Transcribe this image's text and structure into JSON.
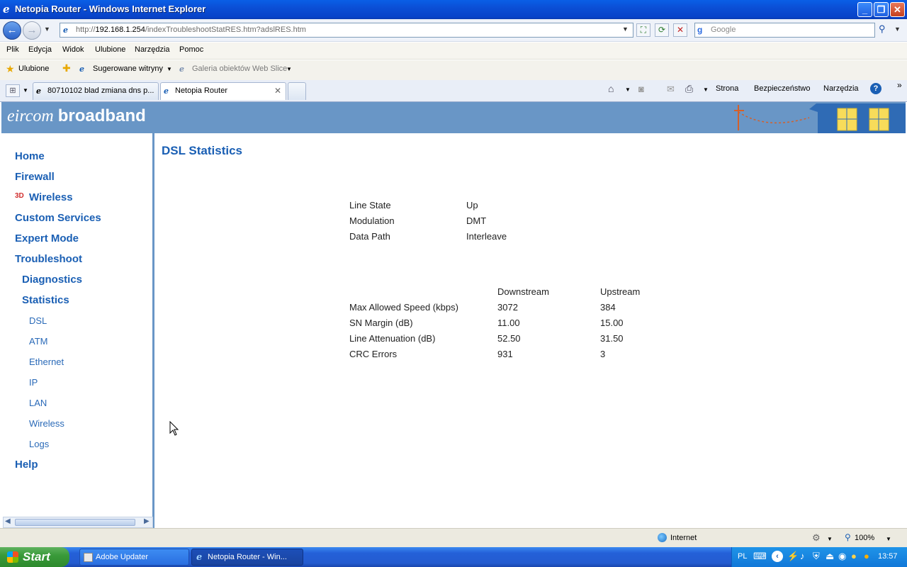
{
  "window": {
    "title": "Netopia Router - Windows Internet Explorer"
  },
  "toolbar": {
    "url_prefix": "http://",
    "url_host": "192.168.1.254",
    "url_path": "/indexTroubleshootStatRES.htm?adslRES.htm",
    "search_placeholder": "Google"
  },
  "menu": [
    "Plik",
    "Edycja",
    "Widok",
    "Ulubione",
    "Narzędzia",
    "Pomoc"
  ],
  "favorites": {
    "label": "Ulubione",
    "items": [
      "Sugerowane witryny",
      "Galeria obiektów Web Slice"
    ]
  },
  "tabs": [
    {
      "label": "80710102 blad zmiana dns p..."
    },
    {
      "label": "Netopia Router"
    }
  ],
  "commands": [
    "Strona",
    "Bezpieczeństwo",
    "Narzędzia"
  ],
  "banner": {
    "brand_light": "eircom",
    "brand_bold": "broadband"
  },
  "sidebar": {
    "home": "Home",
    "firewall": "Firewall",
    "wireless": "Wireless",
    "custom": "Custom Services",
    "expert": "Expert Mode",
    "troubleshoot": "Troubleshoot",
    "diagnostics": "Diagnostics",
    "statistics": "Statistics",
    "stats_items": [
      "DSL",
      "ATM",
      "Ethernet",
      "IP",
      "LAN",
      "Wireless",
      "Logs"
    ],
    "help": "Help",
    "wireless_badge": "3D"
  },
  "main": {
    "title": "DSL Statistics",
    "line_info": [
      {
        "label": "Line State",
        "value": "Up"
      },
      {
        "label": "Modulation",
        "value": "DMT"
      },
      {
        "label": "Data Path",
        "value": "Interleave"
      }
    ],
    "table_headers": [
      "Downstream",
      "Upstream"
    ],
    "table_rows": [
      {
        "label": "Max Allowed Speed (kbps)",
        "down": "3072",
        "up": "384"
      },
      {
        "label": "SN Margin (dB)",
        "down": "11.00",
        "up": "15.00"
      },
      {
        "label": "Line Attenuation (dB)",
        "down": "52.50",
        "up": "31.50"
      },
      {
        "label": "CRC Errors",
        "down": "931",
        "up": "3"
      }
    ]
  },
  "status": {
    "zone": "Internet",
    "zoom": "100%"
  },
  "taskbar": {
    "start": "Start",
    "tasks": [
      "Adobe Updater",
      "Netopia Router - Win..."
    ],
    "lang": "PL",
    "clock": "13:57"
  }
}
